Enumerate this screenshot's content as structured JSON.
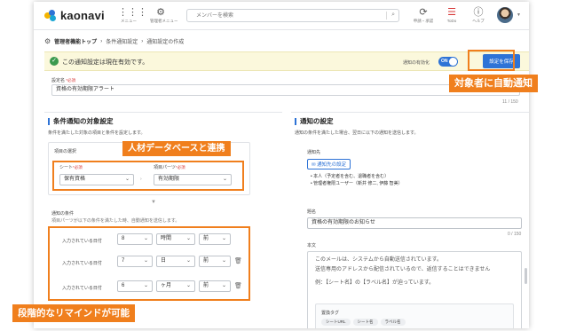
{
  "app": {
    "logo_text": "kaonavi",
    "menu_label": "メニュー",
    "admin_label": "管理者メニュー",
    "search_placeholder": "メンバーを検索",
    "approval_label": "申請・承認",
    "todo_label": "ToDo",
    "help_label": "ヘルプ"
  },
  "breadcrumb": {
    "items": [
      "管理者機能トップ",
      "条件通知設定",
      "通知設定の作成"
    ]
  },
  "notice": {
    "message": "この通知設定は現在有効です。",
    "toggle_label": "通知の有効化",
    "toggle_state": "ON",
    "save_label": "設定を保存"
  },
  "callouts": {
    "auto_notify": "対象者に自動通知",
    "db_link": "人材データベースと連携",
    "reminder": "段階的なリマインドが可能"
  },
  "setting_name": {
    "label": "設定名",
    "required": "*必須",
    "value": "資格の有効期限アラート",
    "count": "11 / 150"
  },
  "left_panel": {
    "title": "条件通知の対象設定",
    "description": "条件を満たした対象の項目と条件を設定します。",
    "item_select_label": "項目の選択",
    "sheet_label": "シート",
    "sheet_value": "保有資格",
    "parts_label": "項目パーツ",
    "parts_value": "有効期限",
    "condition_label": "通知の条件",
    "condition_desc": "項目パーツが以下の条件を満たした時、自動通知を送信します。",
    "rows": [
      {
        "label": "入力されている日付",
        "number": "8",
        "unit": "時間",
        "dir": "前"
      },
      {
        "label": "入力されている日付",
        "number": "7",
        "unit": "日",
        "dir": "前"
      },
      {
        "label": "入力されている日付",
        "number": "6",
        "unit": "ヶ月",
        "dir": "前"
      }
    ]
  },
  "right_panel": {
    "title": "通知の設定",
    "description": "通知の条件を満たした場合、翌日に以下の通知を送信します。",
    "recipients_label": "通知先",
    "recipients_button": "通知先の設定",
    "recipients": [
      "本人（予定者を含む、退職者を含む）",
      "管理者権限ユーザー（新井 修二, 伊藤 智美）"
    ],
    "subject_label": "題名",
    "subject_value": "資格の有効期限のお知らせ",
    "subject_count": "0 / 150",
    "body_label": "本文",
    "body_lines": [
      "このメールは、システムから自動送信されています。",
      "送信専用のアドレスから配信されているので、返信することはできません",
      "",
      "例：【シート名】の【ラベル名】が迫っています。"
    ],
    "tags_label": "置換タグ",
    "tags": [
      "シートURL",
      "シート名",
      "ラベル名"
    ]
  },
  "colors": {
    "accent": "#2e73d6",
    "highlight": "#f07f1d",
    "notice_bg": "#fbf8dc"
  }
}
